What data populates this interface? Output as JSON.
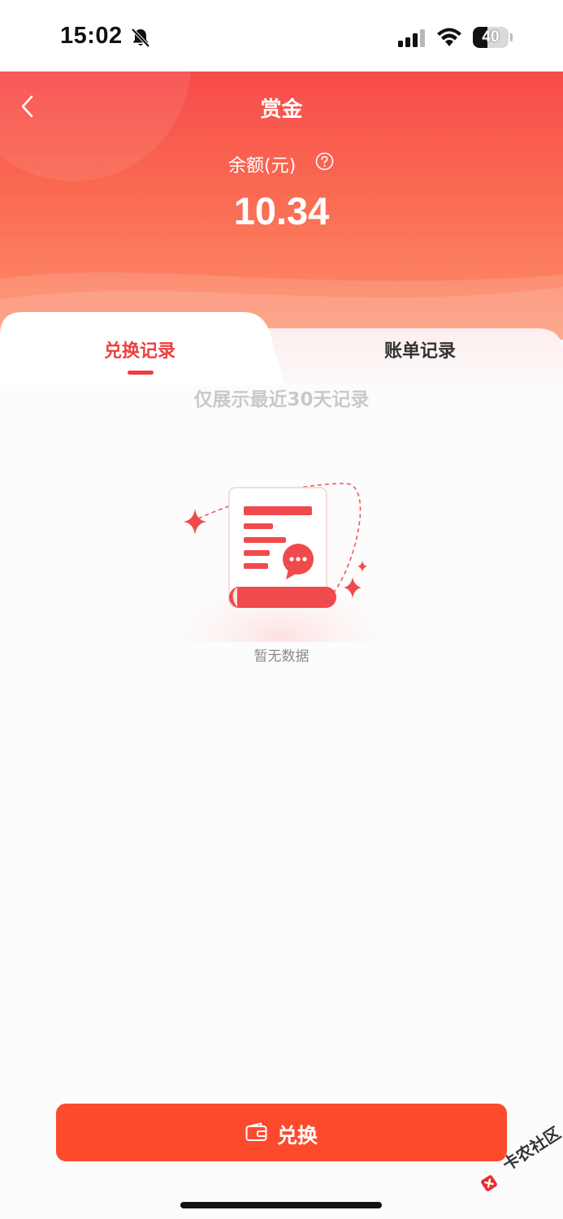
{
  "status_bar": {
    "time": "15:02",
    "battery": "40",
    "battery_level": 0.4
  },
  "header": {
    "title": "赏金",
    "balance_label": "余额(元)",
    "balance_value": "10.34"
  },
  "tabs": [
    {
      "label": "兑换记录",
      "active": true
    },
    {
      "label": "账单记录",
      "active": false
    }
  ],
  "notice": "仅展示最近30天记录",
  "empty_state": {
    "text": "暂无数据"
  },
  "footer": {
    "button_label": "兑换"
  },
  "watermark": "卡农社区",
  "colors": {
    "accent": "#ee3f3f",
    "header_top": "#f74b4a",
    "header_bottom": "#fd8f6b",
    "button": "#fe4a2c"
  }
}
